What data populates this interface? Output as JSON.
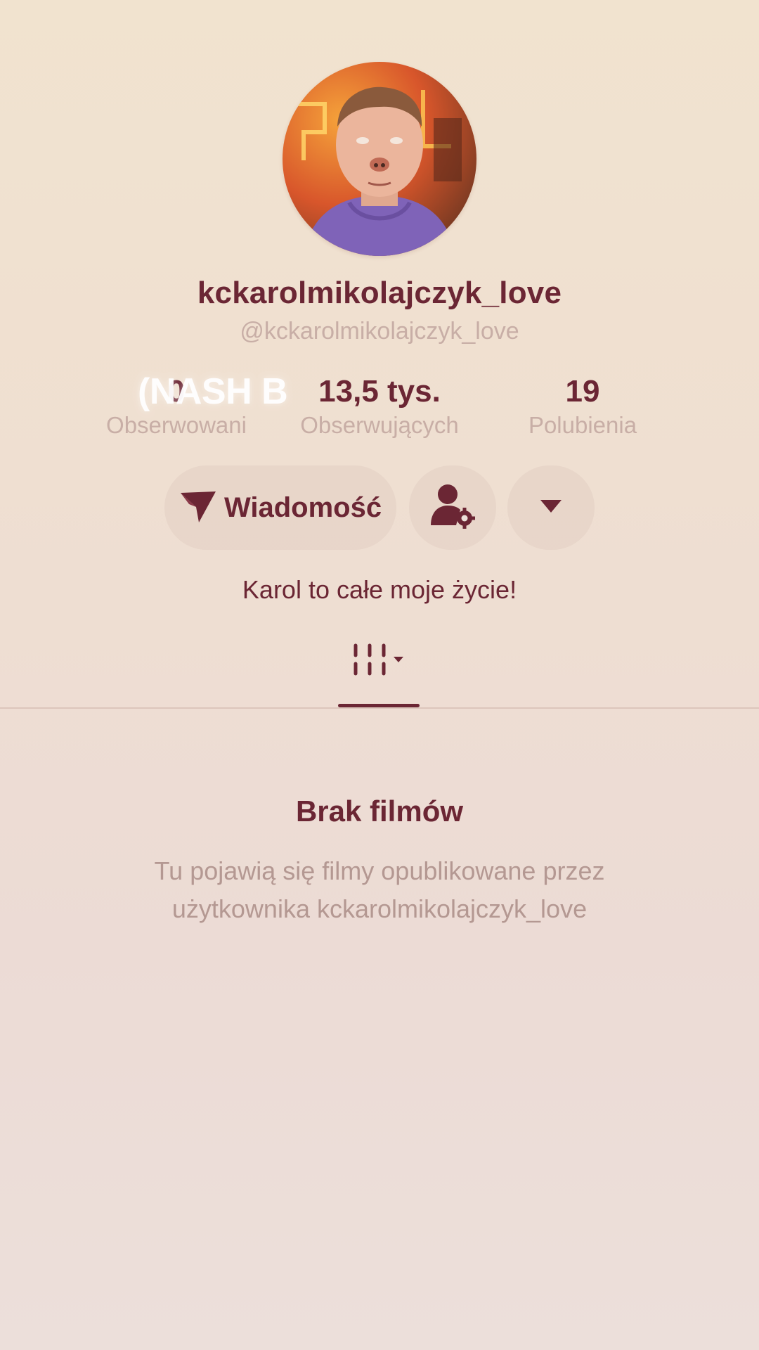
{
  "profile": {
    "display_name": "kckarolmikolajczyk_love",
    "handle": "@kckarolmikolajczyk_love",
    "bio": "Karol to całe moje życie!"
  },
  "stats": {
    "following": {
      "value": "0",
      "label": "Obserwowani"
    },
    "followers": {
      "value": "13,5 tys.",
      "label": "Obserwujących"
    },
    "likes": {
      "value": "19",
      "label": "Polubienia"
    }
  },
  "overlay": {
    "text": "(NASH B"
  },
  "actions": {
    "message_label": "Wiadomość",
    "message_icon": "send-icon",
    "friends_icon": "user-settings-icon",
    "more_icon": "chevron-down-icon"
  },
  "tabs": [
    {
      "icon": "grid-icon",
      "active": true
    }
  ],
  "empty_state": {
    "title": "Brak filmów",
    "description": "Tu pojawią się filmy opublikowane przez użytkownika kckarolmikolajczyk_love"
  },
  "colors": {
    "accent": "#6b2634",
    "muted": "#c8aea6",
    "background": "#efdfd3"
  }
}
